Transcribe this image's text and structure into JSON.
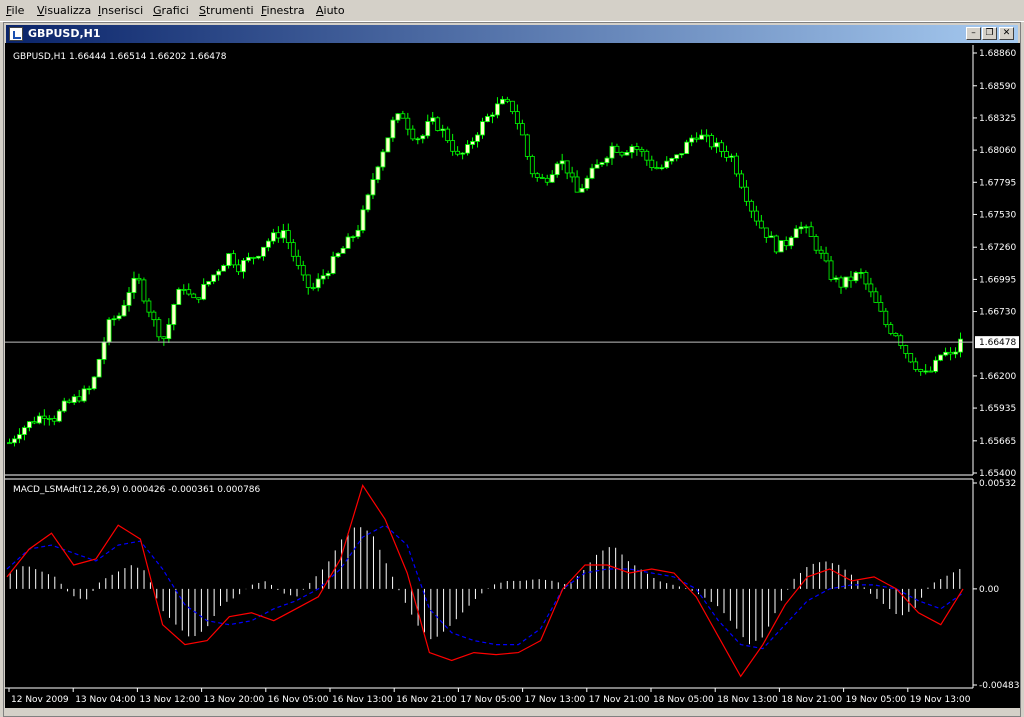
{
  "menu": [
    "File",
    "Visualizza",
    "Inserisci",
    "Grafici",
    "Strumenti",
    "Finestra",
    "Aiuto"
  ],
  "window": {
    "title": "GBPUSD,H1",
    "buttons": [
      "minimize",
      "restore",
      "close"
    ]
  },
  "colors": {
    "background": "#000000",
    "candle_bull": "#ffffcc",
    "candle_bear": "#000000",
    "wick": "#00ff00",
    "price_line": "#c0c0c0",
    "macd_hist": "#ffffff",
    "macd_line": "#ff0000",
    "signal_line": "#0000ff",
    "axis_text": "#ffffff"
  },
  "chart_data": [
    {
      "type": "candlestick",
      "title": "GBPUSD,H1  1.66444 1.66514 1.66202 1.66478",
      "ylim": [
        1.654,
        1.6886
      ],
      "yticks": [
        "1.68860",
        "1.68590",
        "1.68325",
        "1.68060",
        "1.67795",
        "1.67530",
        "1.67260",
        "1.66995",
        "1.66730",
        "1.66200",
        "1.65935",
        "1.65665",
        "1.65400"
      ],
      "current_price": "1.66478",
      "x_ticks": [
        "12 Nov 2009",
        "13 Nov 04:00",
        "13 Nov 12:00",
        "13 Nov 20:00",
        "16 Nov 05:00",
        "16 Nov 13:00",
        "16 Nov 21:00",
        "17 Nov 05:00",
        "17 Nov 13:00",
        "17 Nov 21:00",
        "18 Nov 05:00",
        "18 Nov 13:00",
        "18 Nov 21:00",
        "19 Nov 05:00",
        "19 Nov 13:00"
      ],
      "close_path": [
        1.6565,
        1.6575,
        1.658,
        1.6585,
        1.659,
        1.6585,
        1.6595,
        1.66,
        1.6605,
        1.661,
        1.664,
        1.6665,
        1.667,
        1.669,
        1.67,
        1.668,
        1.666,
        1.665,
        1.668,
        1.6695,
        1.668,
        1.669,
        1.67,
        1.671,
        1.672,
        1.671,
        1.6715,
        1.672,
        1.673,
        1.6735,
        1.674,
        1.672,
        1.67,
        1.669,
        1.67,
        1.671,
        1.672,
        1.673,
        1.674,
        1.676,
        1.679,
        1.681,
        1.683,
        1.6835,
        1.682,
        1.6815,
        1.683,
        1.6825,
        1.6815,
        1.68,
        1.6805,
        1.682,
        1.683,
        1.684,
        1.6845,
        1.684,
        1.682,
        1.679,
        1.678,
        1.6785,
        1.68,
        1.679,
        1.677,
        1.678,
        1.679,
        1.68,
        1.681,
        1.6805,
        1.681,
        1.6805,
        1.6795,
        1.679,
        1.6795,
        1.68,
        1.681,
        1.682,
        1.6815,
        1.681,
        1.6805,
        1.68,
        1.678,
        1.676,
        1.6745,
        1.6735,
        1.6725,
        1.673,
        1.6745,
        1.674,
        1.673,
        1.6715,
        1.67,
        1.6695,
        1.67,
        1.6705,
        1.669,
        1.6675,
        1.666,
        1.6655,
        1.664,
        1.663,
        1.662,
        1.6625,
        1.664,
        1.6635,
        1.6648
      ],
      "candle_count": 192
    },
    {
      "type": "bar+line",
      "title": "MACD_LSMAdt(12,26,9) 0.000426 -0.000361 0.000786",
      "ylim": [
        -0.00483,
        0.00532
      ],
      "yticks": [
        "0.00532",
        "0.00",
        "-0.00483"
      ],
      "series": [
        {
          "kind": "histogram",
          "values": [
            0.0008,
            0.0012,
            0.0009,
            0.0006,
            -0.0003,
            -0.0006,
            0.0004,
            0.0008,
            0.0012,
            0.0009,
            -0.001,
            -0.0018,
            -0.0025,
            -0.002,
            -0.0008,
            -0.0004,
            0.0002,
            0.0004,
            -0.0002,
            -0.0004,
            0.0004,
            0.0012,
            0.0025,
            0.0032,
            0.0028,
            0.0012,
            -0.0004,
            -0.0018,
            -0.0026,
            -0.002,
            -0.0012,
            -0.0004,
            0.0002,
            0.0004,
            0.0004,
            0.0005,
            0.0004,
            0.0002,
            0.0009,
            0.0018,
            0.0022,
            0.0014,
            0.0009,
            0.0004,
            0.0002,
            0.0,
            -0.0004,
            -0.0009,
            -0.0018,
            -0.0028,
            -0.0024,
            -0.0008,
            0.0005,
            0.0012,
            0.0014,
            0.0012,
            0.0006,
            -0.0002,
            -0.0008,
            -0.0014,
            -0.001,
            0.0002,
            0.0006,
            0.001
          ]
        },
        {
          "kind": "line",
          "values": [
            0.0006,
            0.002,
            0.0028,
            0.0012,
            0.0015,
            0.0032,
            0.0025,
            -0.0018,
            -0.0028,
            -0.0026,
            -0.0014,
            -0.0012,
            -0.0016,
            -0.001,
            -0.0004,
            0.0015,
            0.0052,
            0.0035,
            0.0008,
            -0.0032,
            -0.0036,
            -0.0032,
            -0.0033,
            -0.0032,
            -0.0026,
            0.0,
            0.0012,
            0.0012,
            0.0008,
            0.001,
            0.0008,
            -0.0004,
            -0.0024,
            -0.0044,
            -0.0028,
            -0.0008,
            0.0006,
            0.001,
            0.0004,
            0.0006,
            0.0,
            -0.0012,
            -0.0018,
            0.0
          ]
        },
        {
          "kind": "line-dashed",
          "values": [
            0.001,
            0.002,
            0.0022,
            0.0018,
            0.0014,
            0.0022,
            0.0024,
            0.001,
            -0.0008,
            -0.0016,
            -0.0018,
            -0.0016,
            -0.001,
            -0.0006,
            0.0,
            0.001,
            0.0026,
            0.0032,
            0.0022,
            -0.001,
            -0.0022,
            -0.0026,
            -0.0028,
            -0.0028,
            -0.002,
            0.0,
            0.0008,
            0.001,
            0.001,
            0.0008,
            0.0006,
            0.0,
            -0.0016,
            -0.0028,
            -0.003,
            -0.0018,
            -0.0006,
            0.0,
            0.0002,
            0.0002,
            0.0,
            -0.0006,
            -0.001,
            -0.0002
          ]
        }
      ]
    }
  ]
}
